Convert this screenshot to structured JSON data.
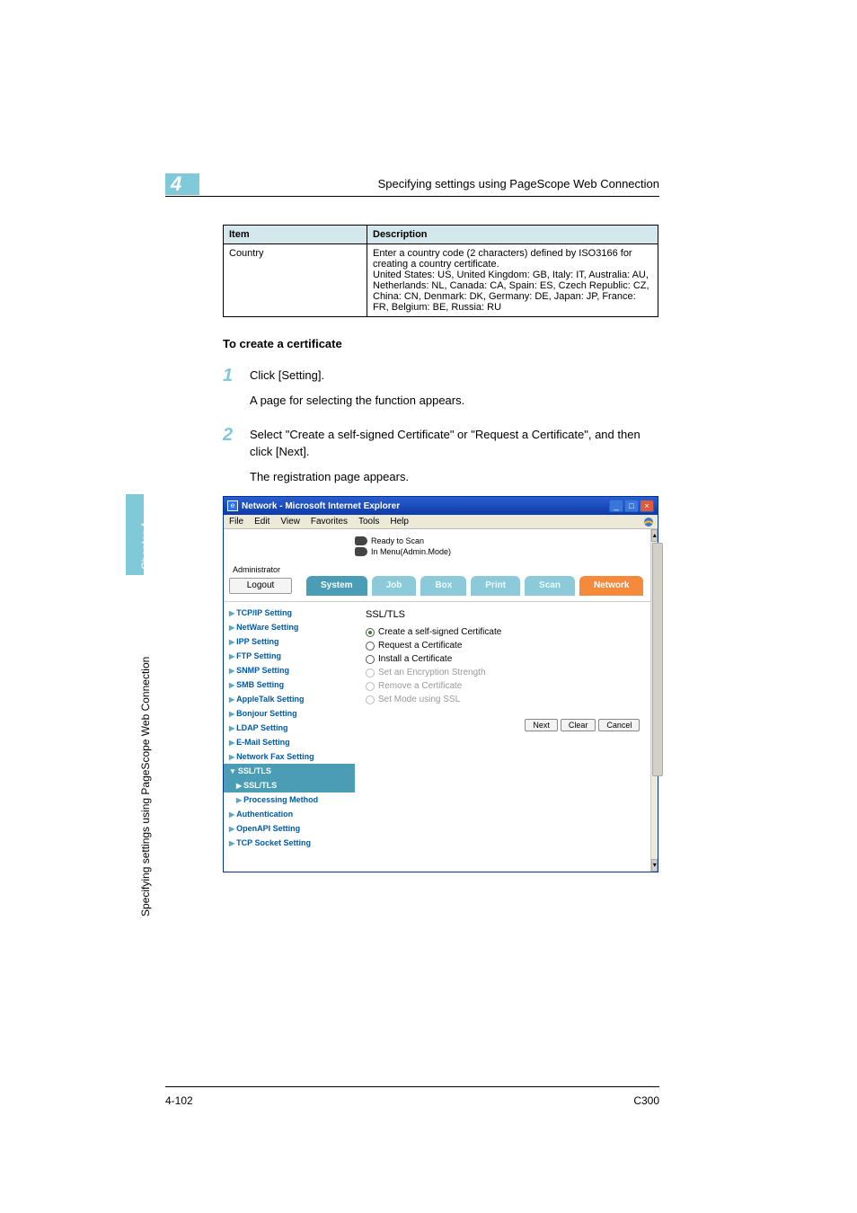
{
  "header": {
    "chapter_num": "4",
    "title": "Specifying settings using PageScope Web Connection"
  },
  "table": {
    "head_item": "Item",
    "head_desc": "Description",
    "row_item": "Country",
    "row_desc": "Enter a country code (2 characters) defined by ISO3166 for creating a country certificate.\nUnited States: US, United Kingdom: GB, Italy: IT, Australia: AU, Netherlands: NL, Canada: CA, Spain: ES, Czech Republic: CZ, China: CN, Denmark: DK, Germany: DE, Japan: JP, France: FR, Belgium: BE, Russia: RU"
  },
  "section_title": "To create a certificate",
  "steps": {
    "s1_num": "1",
    "s1_text": "Click [Setting].",
    "s1_sub": "A page for selecting the function appears.",
    "s2_num": "2",
    "s2_text": "Select \"Create a self-signed Certificate\" or \"Request a Certificate\", and then click [Next].",
    "s2_sub": "The registration page appears."
  },
  "screenshot": {
    "window_title": "Network - Microsoft Internet Explorer",
    "menu": {
      "file": "File",
      "edit": "Edit",
      "view": "View",
      "favorites": "Favorites",
      "tools": "Tools",
      "help": "Help"
    },
    "status1": "Ready to Scan",
    "status2": "In Menu(Admin.Mode)",
    "admin": "Administrator",
    "logout": "Logout",
    "tabs": {
      "system": "System",
      "job": "Job",
      "box": "Box",
      "print": "Print",
      "scan": "Scan",
      "network": "Network"
    },
    "sidebar": {
      "tcpip": "TCP/IP Setting",
      "netware": "NetWare Setting",
      "ipp": "IPP Setting",
      "ftp": "FTP Setting",
      "snmp": "SNMP Setting",
      "smb": "SMB Setting",
      "appletalk": "AppleTalk Setting",
      "bonjour": "Bonjour Setting",
      "ldap": "LDAP Setting",
      "email": "E-Mail Setting",
      "netfax": "Network Fax Setting",
      "ssltls_parent": "SSL/TLS",
      "ssltls_child": "SSL/TLS",
      "processing": "Processing Method",
      "auth": "Authentication",
      "openapi": "OpenAPI Setting",
      "tcpsocket": "TCP Socket Setting"
    },
    "content": {
      "heading": "SSL/TLS",
      "opt1": "Create a self-signed Certificate",
      "opt2": "Request a Certificate",
      "opt3": "Install a Certificate",
      "opt4": "Set an Encryption Strength",
      "opt5": "Remove a Certificate",
      "opt6": "Set Mode using SSL",
      "btn_next": "Next",
      "btn_clear": "Clear",
      "btn_cancel": "Cancel"
    }
  },
  "side": {
    "chapter": "Chapter 4",
    "label": "Specifying settings using PageScope Web Connection"
  },
  "footer": {
    "page": "4-102",
    "model": "C300"
  }
}
